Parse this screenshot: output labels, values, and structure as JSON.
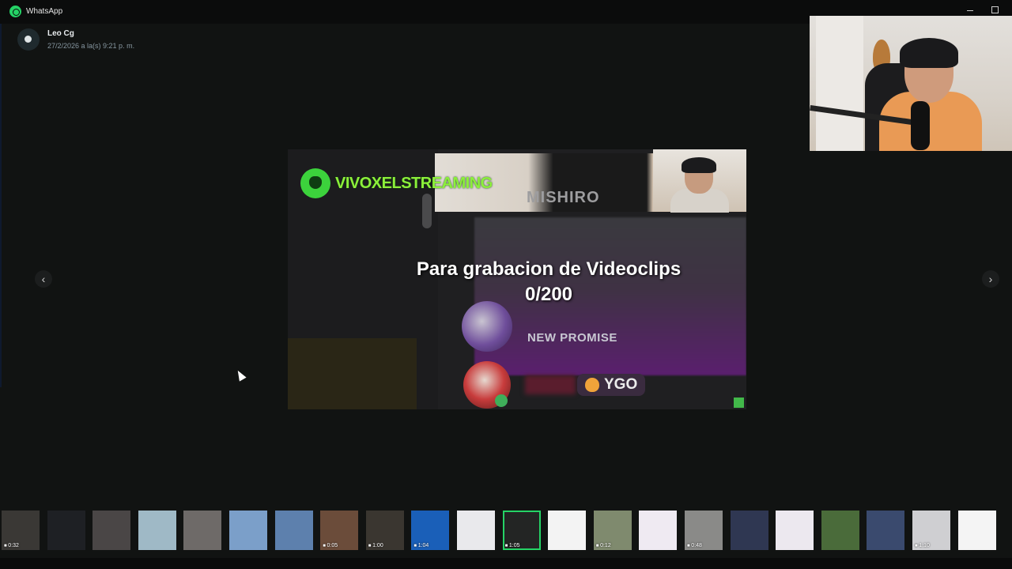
{
  "window": {
    "title": "WhatsApp"
  },
  "sender": {
    "name": "Leo Cg",
    "timestamp": "27/2/2026 a la(s) 9:21 p. m."
  },
  "video": {
    "channel_name": "VIVOXELSTREAMING",
    "top_text": "MISHIRO",
    "caption_line1": "Para grabacion de Videoclips",
    "caption_line2": "0/200",
    "badge_text": "NEW PROMISE",
    "badge2_text": "YGO"
  },
  "navigation": {
    "prev_icon": "‹",
    "next_icon": "›"
  },
  "thumbnails": [
    {
      "duration": "0:32",
      "color": "#3a3835"
    },
    {
      "duration": "",
      "color": "#1e2024"
    },
    {
      "duration": "",
      "color": "#4a4646"
    },
    {
      "duration": "",
      "color": "#9fb9c6"
    },
    {
      "duration": "",
      "color": "#6e6a68"
    },
    {
      "duration": "",
      "color": "#7b9fc9"
    },
    {
      "duration": "",
      "color": "#5d80ad"
    },
    {
      "duration": "0:05",
      "color": "#6b4c3a"
    },
    {
      "duration": "1:00",
      "color": "#3a3630"
    },
    {
      "duration": "1:04",
      "color": "#1a5fb8"
    },
    {
      "duration": "",
      "color": "#e9e9ec"
    },
    {
      "duration": "1:05",
      "color": "#232524"
    },
    {
      "duration": "",
      "color": "#f3f3f3"
    },
    {
      "duration": "0:12",
      "color": "#7f8a6e"
    },
    {
      "duration": "",
      "color": "#efeaf2"
    },
    {
      "duration": "0:48",
      "color": "#8a8a88"
    },
    {
      "duration": "",
      "color": "#2f3752"
    },
    {
      "duration": "",
      "color": "#ece8ef"
    },
    {
      "duration": "",
      "color": "#4a6b3a"
    },
    {
      "duration": "",
      "color": "#3a4a6e"
    },
    {
      "duration": "1:10",
      "color": "#cfcfd2"
    },
    {
      "duration": "",
      "color": "#f4f4f4"
    }
  ],
  "active_thumbnail_index": 11,
  "colors": {
    "accent": "#25d366",
    "background": "#111312"
  }
}
